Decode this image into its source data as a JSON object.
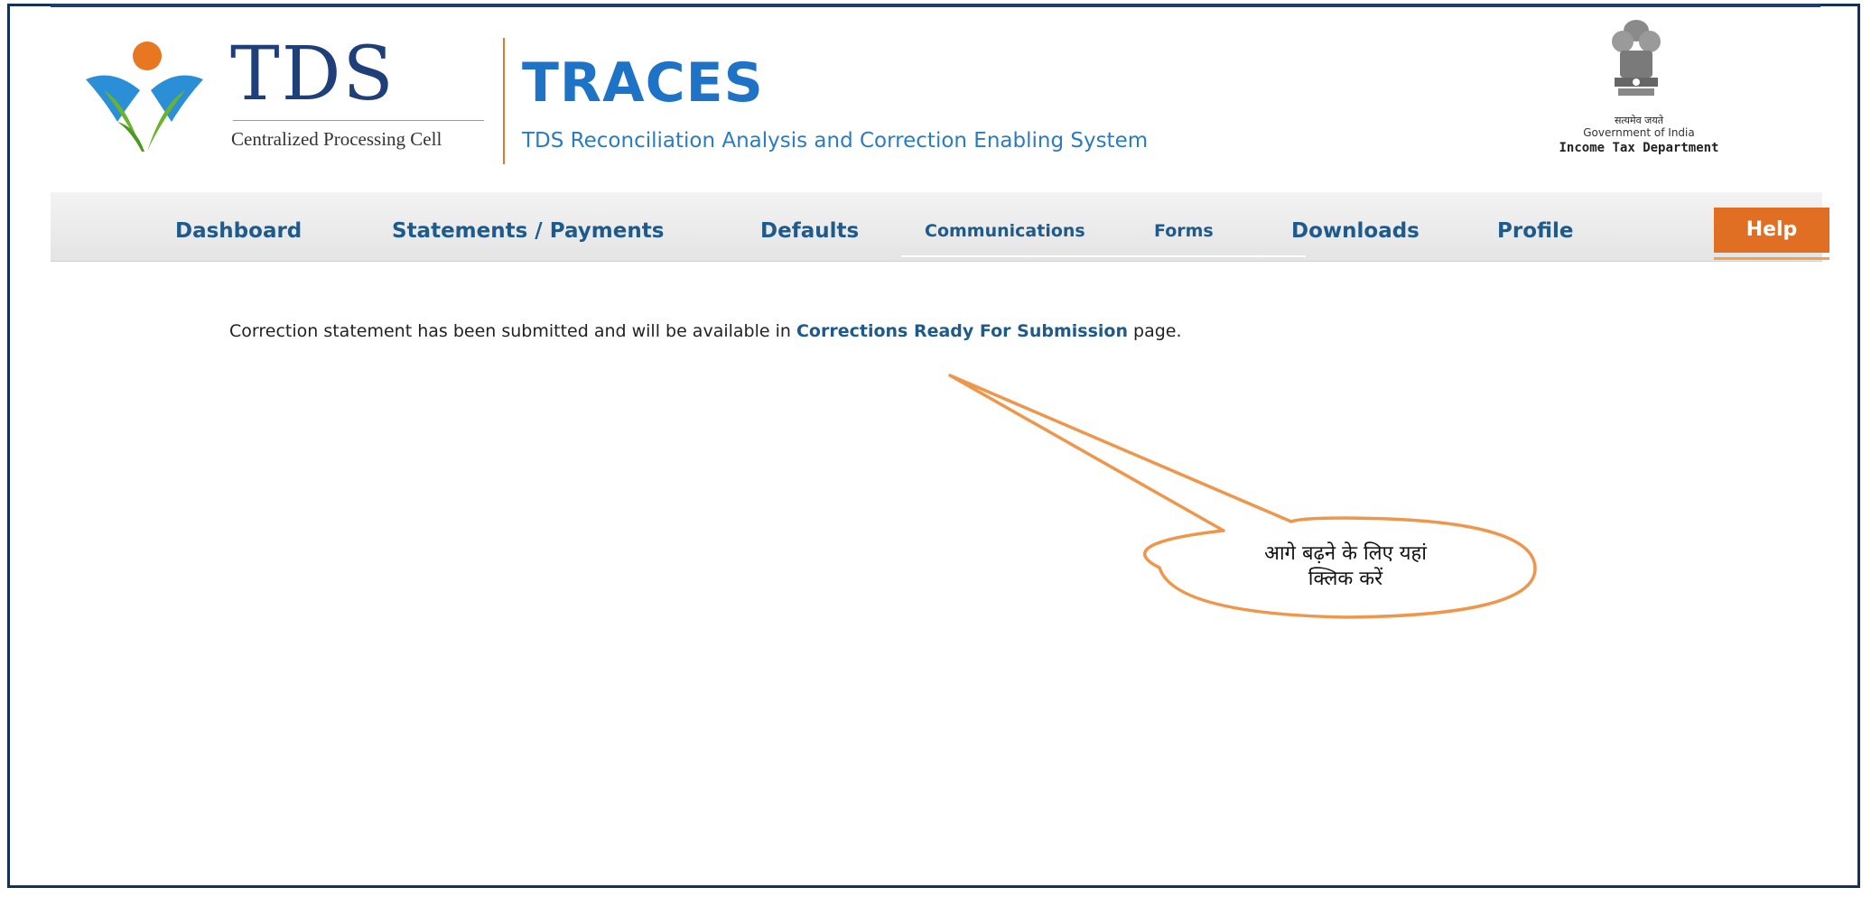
{
  "header": {
    "logo_word": "TDS",
    "logo_subtitle": "Centralized Processing Cell",
    "app_name": "TRACES",
    "app_fullname": "TDS Reconciliation Analysis and Correction Enabling System",
    "gov_motto": "सत्यमेव जयते",
    "gov_name": "Government of India",
    "department": "Income Tax Department"
  },
  "nav": {
    "items": [
      {
        "label": "Dashboard"
      },
      {
        "label": "Statements / Payments"
      },
      {
        "label": "Defaults"
      },
      {
        "label": "Communications"
      },
      {
        "label": "Forms"
      },
      {
        "label": "Downloads"
      },
      {
        "label": "Profile"
      }
    ],
    "help_label": "Help"
  },
  "main": {
    "message_before": "Correction statement has been submitted and will be available in ",
    "message_link": "Corrections Ready For Submission",
    "message_after": " page."
  },
  "callout": {
    "line1": "आगे बढ़ने के लिए यहां",
    "line2": "क्लिक करें"
  },
  "colors": {
    "frame": "#14305c",
    "nav_text": "#1e5a8c",
    "help_bg": "#e06f24",
    "traces_blue": "#1f73c6",
    "callout_orange": "#f0964a"
  }
}
